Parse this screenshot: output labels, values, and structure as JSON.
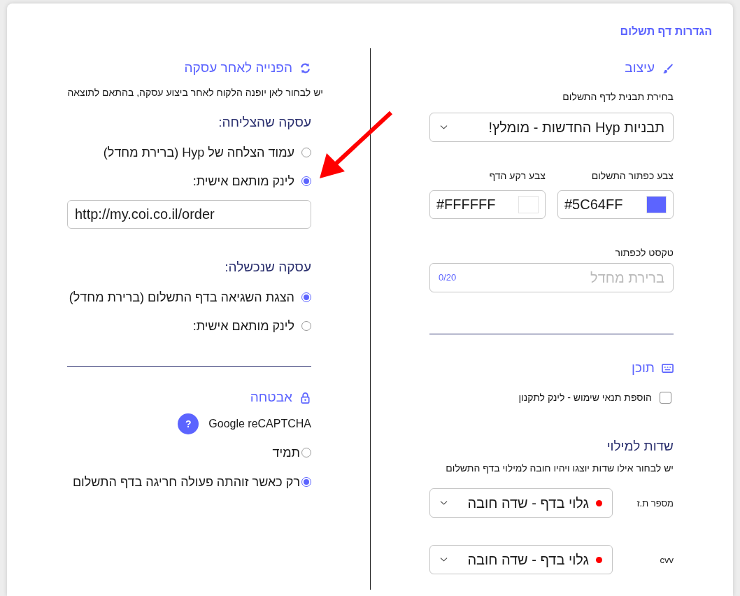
{
  "title": "הגדרות דף תשלום",
  "design": {
    "heading": "עיצוב",
    "template_label": "בחירת תבנית לדף התשלום",
    "template_value": "תבניות Hyp החדשות - מומלץ!",
    "colors": [
      {
        "label": "צבע כפתור התשלום",
        "value": "#5C64FF",
        "color": "#5c64ff"
      },
      {
        "label": "צבע רקע הדף",
        "value": "#FFFFFF",
        "color": "#ffffff"
      }
    ],
    "button_text": {
      "label": "טקסט לכפתור",
      "placeholder": "ברירת מחדל",
      "counter": "0/20"
    }
  },
  "content": {
    "heading": "תוכן",
    "terms": {
      "label": "הוספת תנאי שימוש - לינק לתקנון",
      "checked": false
    }
  },
  "fields": {
    "heading": "שדות למילוי",
    "description": "יש לבחור אילו שדות יוצגו ויהיו חובה למילוי בדף התשלום",
    "rows": [
      {
        "label": "מספר ת.ז",
        "value": "גלוי בדף - שדה חובה"
      },
      {
        "label": "cvv",
        "value": "גלוי בדף - שדה חובה"
      }
    ]
  },
  "redirect": {
    "heading": "הפנייה לאחר עסקה",
    "description": "יש לבחור לאן יופנה הלקוח לאחר ביצוע עסקה, בהתאם לתוצאה",
    "groups": [
      {
        "title": "עסקה שהצליחה:",
        "options": [
          {
            "label": "עמוד הצלחה של Hyp (ברירת מחדל)",
            "selected": false
          },
          {
            "label": "לינק מותאם אישית:",
            "selected": true
          }
        ],
        "url": "http://my.coi.co.il/order"
      },
      {
        "title": "עסקה שנכשלה:",
        "options": [
          {
            "label": "הצגת השגיאה בדף התשלום (ברירת מחדל)",
            "selected": true
          },
          {
            "label": "לינק מותאם אישית:",
            "selected": false
          }
        ]
      }
    ]
  },
  "security": {
    "heading": "אבטחה",
    "recaptcha": {
      "label": "Google reCAPTCHA",
      "help": "?"
    },
    "options": [
      {
        "label": "תמיד",
        "selected": false
      },
      {
        "label": "רק כאשר זוהתה פעולה חריגה בדף התשלום",
        "selected": true
      }
    ]
  }
}
